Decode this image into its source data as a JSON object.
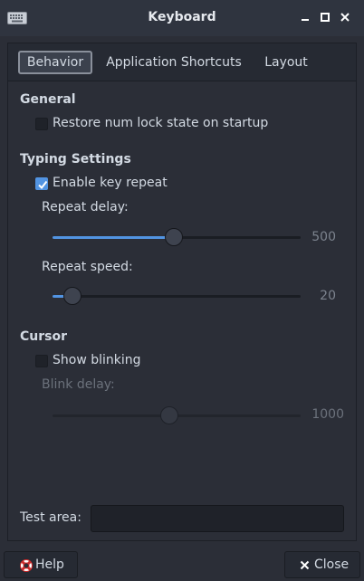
{
  "window": {
    "title": "Keyboard"
  },
  "tabs": [
    {
      "label": "Behavior",
      "active": true
    },
    {
      "label": "Application Shortcuts",
      "active": false
    },
    {
      "label": "Layout",
      "active": false
    }
  ],
  "general": {
    "heading": "General",
    "numlock": {
      "label": "Restore num lock state on startup",
      "checked": false
    }
  },
  "typing": {
    "heading": "Typing Settings",
    "key_repeat": {
      "label": "Enable key repeat",
      "checked": true
    },
    "repeat_delay": {
      "label": "Repeat delay:",
      "value": "500",
      "fraction": 0.49
    },
    "repeat_speed": {
      "label": "Repeat speed:",
      "value": "20",
      "fraction": 0.08
    }
  },
  "cursor": {
    "heading": "Cursor",
    "blinking": {
      "label": "Show blinking",
      "checked": false
    },
    "blink_delay": {
      "label": "Blink delay:",
      "value": "1000",
      "fraction": 0.47
    }
  },
  "test_area": {
    "label": "Test area:",
    "value": ""
  },
  "buttons": {
    "help": "Help",
    "close": "Close"
  },
  "colors": {
    "accent": "#5294e2",
    "background": "#2b2e37",
    "titlebar": "#2f343f"
  }
}
